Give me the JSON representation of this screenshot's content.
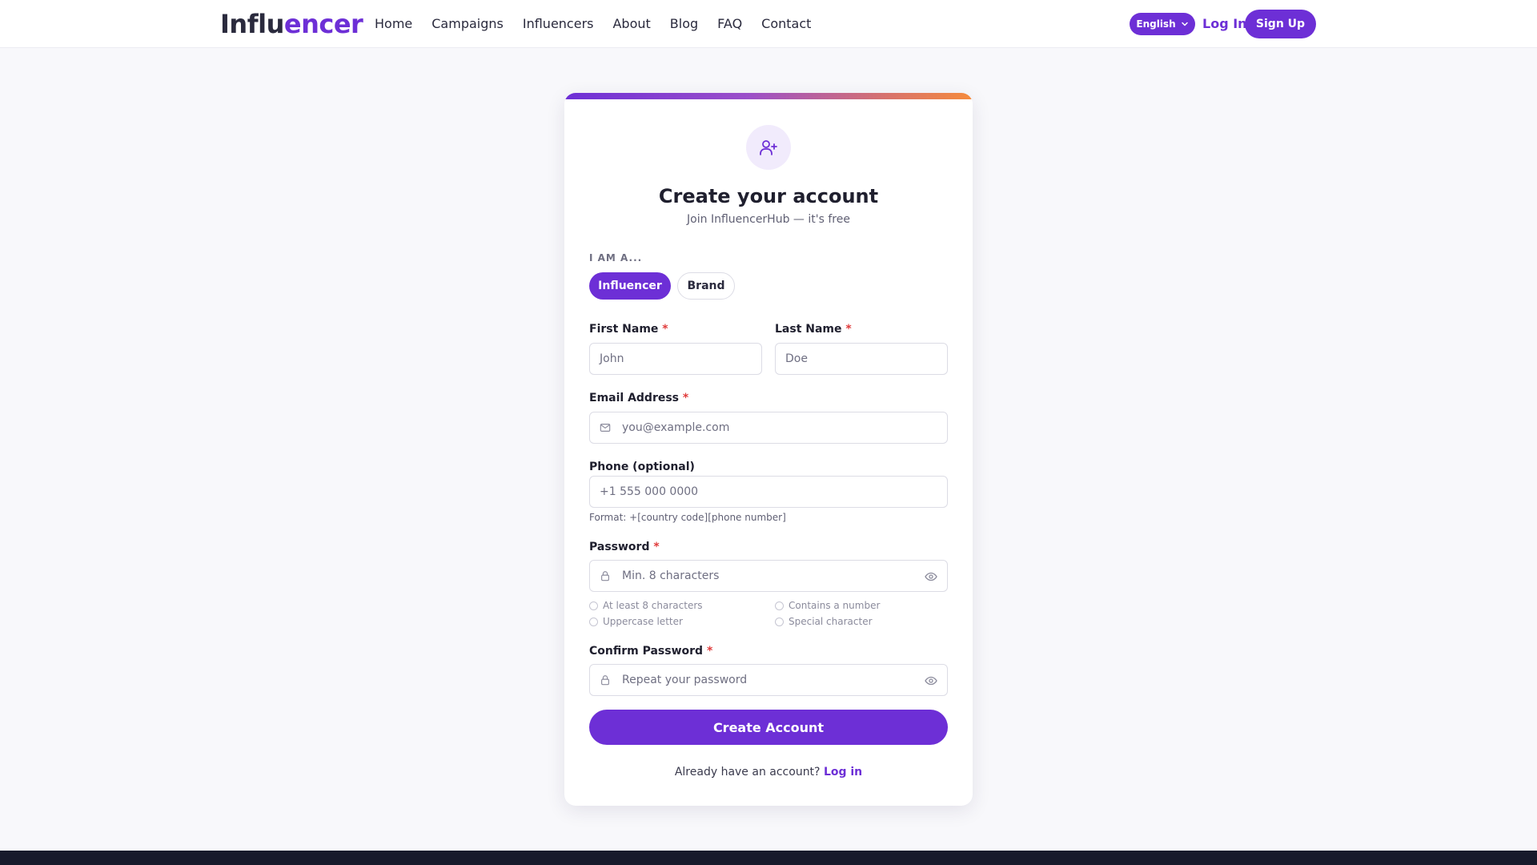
{
  "nav": {
    "brand_part1": "Influ",
    "brand_part2": "encer",
    "links": [
      "Home",
      "Campaigns",
      "Influencers",
      "About",
      "Blog",
      "FAQ",
      "Contact"
    ],
    "language": "English",
    "login": "Log In",
    "signup": "Sign Up"
  },
  "form": {
    "title": "Create your account",
    "subtitle": "Join InfluencerHub — it's free",
    "role_label": "I AM A...",
    "roles": {
      "influencer": "Influencer",
      "brand": "Brand"
    },
    "selected_role": "Influencer",
    "first_name": {
      "label": "First Name",
      "placeholder": "John"
    },
    "last_name": {
      "label": "Last Name",
      "placeholder": "Doe"
    },
    "email": {
      "label": "Email Address",
      "placeholder": "you@example.com"
    },
    "phone": {
      "label": "Phone (optional)",
      "placeholder": "+1 555 000 0000",
      "hint": "Format: +[country code][phone number]"
    },
    "password": {
      "label": "Password",
      "placeholder": "Min. 8 characters",
      "requirements": [
        "At least 8 characters",
        "Contains a number",
        "Uppercase letter",
        "Special character"
      ]
    },
    "confirm_password": {
      "label": "Confirm Password",
      "placeholder": "Repeat your password"
    },
    "required_mark": "*",
    "submit": "Create Account",
    "already_text": "Already have an account?",
    "login_link": "Log in"
  },
  "colors": {
    "accent": "#6d2fd6",
    "required": "#e03b3b",
    "gradient_end": "#f58b3c",
    "footer": "#171a2b"
  },
  "icons": {
    "avatar": "user-plus-icon",
    "email": "mail-icon",
    "password": "lock-icon",
    "toggle": "eye-icon",
    "language": "chevron-down-icon"
  }
}
